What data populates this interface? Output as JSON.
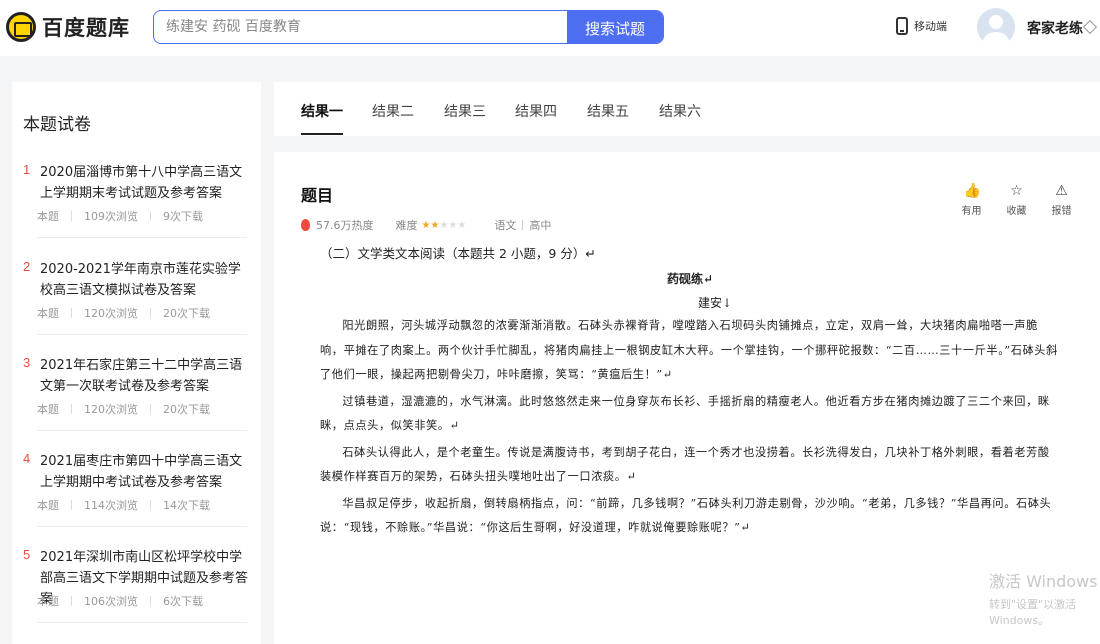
{
  "header": {
    "logo_text": "百度题库",
    "search_placeholder": "练建安 药砚 百度教育",
    "search_button": "搜索试题",
    "mobile_label": "移动端",
    "username": "客家老练"
  },
  "sidebar": {
    "title": "本题试卷",
    "items": [
      {
        "num": "1",
        "title": "2020届淄博市第十八中学高三语文上学期期末考试试题及参考答案",
        "tag": "本题",
        "views": "109次浏览",
        "downloads": "9次下载"
      },
      {
        "num": "2",
        "title": "2020-2021学年南京市莲花实验学校高三语文模拟试卷及答案",
        "tag": "本题",
        "views": "120次浏览",
        "downloads": "20次下载"
      },
      {
        "num": "3",
        "title": "2021年石家庄第三十二中学高三语文第一次联考试卷及参考答案",
        "tag": "本题",
        "views": "120次浏览",
        "downloads": "20次下载"
      },
      {
        "num": "4",
        "title": "2021届枣庄市第四十中学高三语文上学期期中考试试卷及参考答案",
        "tag": "本题",
        "views": "114次浏览",
        "downloads": "14次下载"
      },
      {
        "num": "5",
        "title": "2021年深圳市南山区松坪学校中学部高三语文下学期期中试题及参考答案",
        "tag": "本题",
        "views": "106次浏览",
        "downloads": "6次下载"
      }
    ]
  },
  "tabs": [
    "结果一",
    "结果二",
    "结果三",
    "结果四",
    "结果五",
    "结果六"
  ],
  "question": {
    "title": "题目",
    "heat": "57.6万热度",
    "difficulty_label": "难度",
    "difficulty_stars": 2,
    "difficulty_max": 5,
    "subject": "语文",
    "level": "高中",
    "actions": [
      {
        "label": "有用",
        "icon": "thumbs-up-icon",
        "glyph": "👍"
      },
      {
        "label": "收藏",
        "icon": "star-icon",
        "glyph": "☆"
      },
      {
        "label": "报错",
        "icon": "report-icon",
        "glyph": "⚠"
      }
    ],
    "section_heading": "（二）文学类文本阅读（本题共 2 小题，9 分）↵",
    "story_title": "药砚练↵",
    "author": "建安↓",
    "paragraphs": [
      "阳光朗照，河头城浮动飘忽的浓雾渐渐消散。石砵头赤裸脊背，嘡嘡踏入石坝码头肉铺摊点，立定，双肩一耸，大块猪肉扁啪嗒一声脆响，平摊在了肉案上。两个伙计手忙脚乱，将猪肉扁挂上一根钢皮缸木大秤。一个掌挂钩，一个挪秤砣报数：“二百……三十一斤半。”石砵头斜了他们一眼，操起两把剔骨尖刀，咔咔磨擦，笑骂：“黄瘟后生！”↵",
      "过镇巷道，湿漉漉的，水气淋漓。此时悠悠然走来一位身穿灰布长衫、手摇折扇的精瘦老人。他近看方步在猪肉摊边踱了三二个来回，眯眯，点点头，似笑非笑。↵",
      "石砵头认得此人，是个老童生。传说是满腹诗书，考到胡子花白，连一个秀才也没捞着。长衫洗得发白，几块补丁格外刺眼，看着老芳酸装模作样赛百万的架势，石砵头扭头噗地吐出了一口浓痰。↵",
      "华昌叔足停步，收起折扇，倒转扇柄指点，问：“前蹄，几多钱啊？”石砵头利刀游走剔骨，沙沙响。“老弟，几多钱？”华昌再问。石砵头说：“现钱，不赊账。”华昌说：“你这后生哥啊，好没道理，咋就说俺要赊账呢？”↵"
    ]
  },
  "watermark": {
    "line1": "激活 Windows",
    "line2": "转到\"设置\"以激活 Windows。"
  }
}
